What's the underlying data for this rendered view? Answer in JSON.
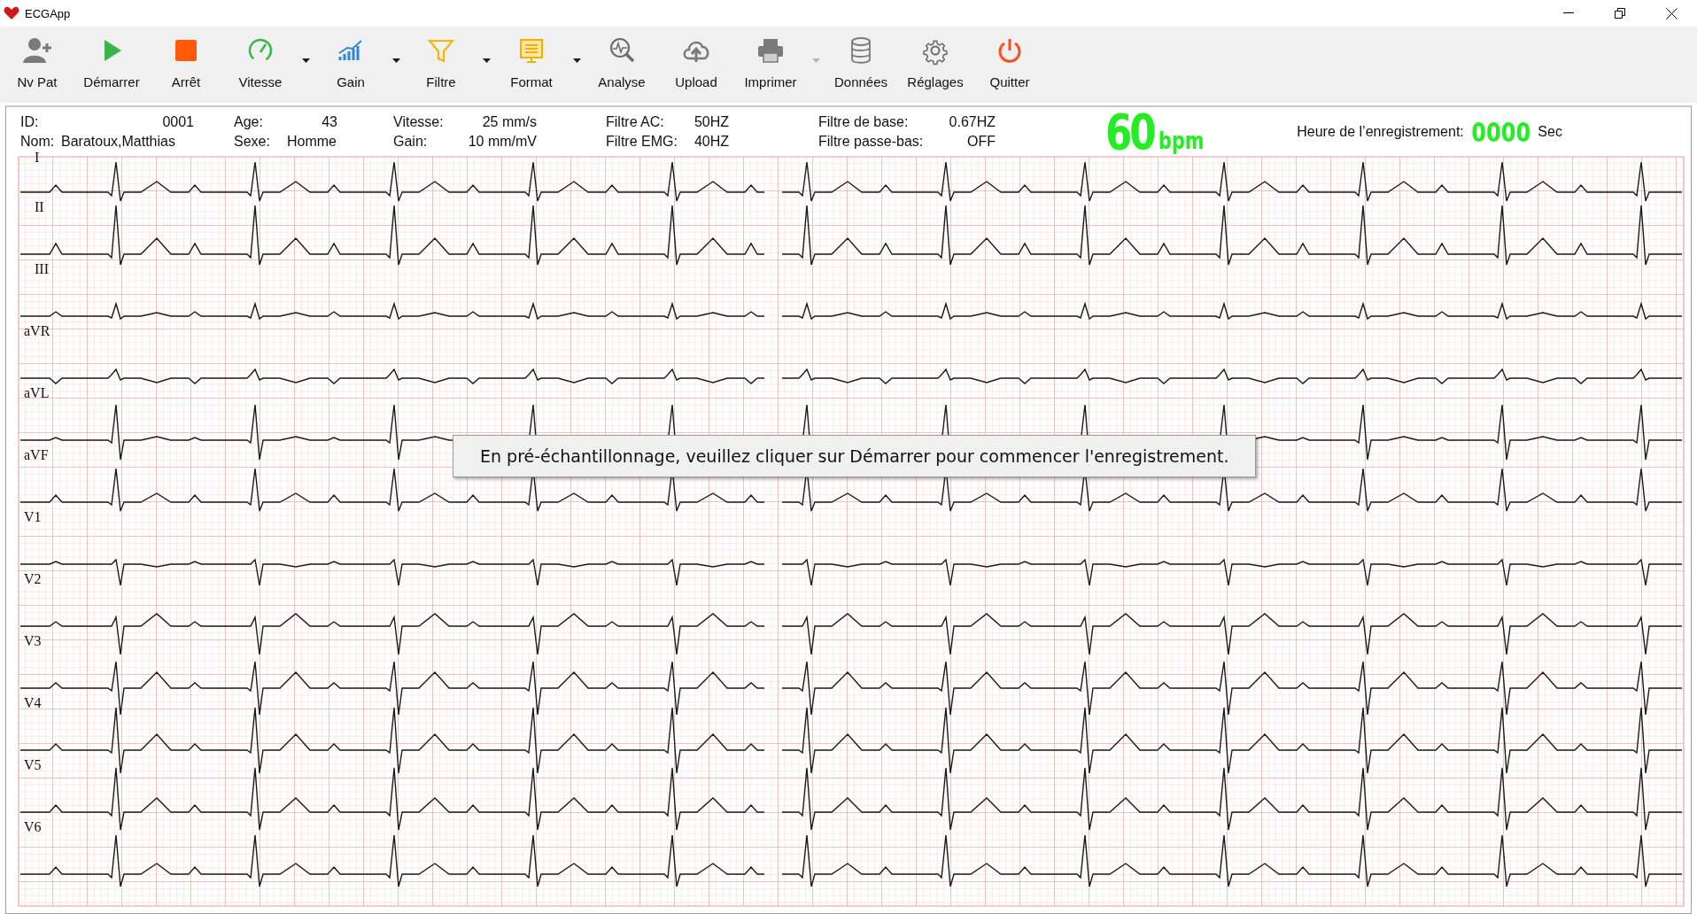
{
  "window": {
    "title": "ECGApp"
  },
  "toolbar": [
    {
      "label": "Nv Pat"
    },
    {
      "label": "Démarrer"
    },
    {
      "label": "Arrêt"
    },
    {
      "label": "Vitesse",
      "dropdown": true,
      "dropdown_disabled": false
    },
    {
      "label": "Gain",
      "dropdown": true,
      "dropdown_disabled": false
    },
    {
      "label": "Filtre",
      "dropdown": true,
      "dropdown_disabled": false
    },
    {
      "label": "Format",
      "dropdown": true,
      "dropdown_disabled": false
    },
    {
      "label": "Analyse"
    },
    {
      "label": "Upload"
    },
    {
      "label": "Imprimer",
      "dropdown": true,
      "dropdown_disabled": true
    },
    {
      "label": "Données"
    },
    {
      "label": "Réglages"
    },
    {
      "label": "Quitter"
    }
  ],
  "patient_info": [
    {
      "label": "ID:",
      "value": "0001",
      "label2": "Nom:",
      "value2": "Baratoux,Matthias"
    },
    {
      "label": "Age:",
      "value": "43",
      "label2": "Sexe:",
      "value2": "Homme"
    },
    {
      "label": "Vitesse:",
      "value": "25 mm/s",
      "label2": "Gain:",
      "value2": "10 mm/mV"
    },
    {
      "label": "Filtre AC:",
      "value": "50HZ",
      "label2": "Filtre EMG:",
      "value2": "40HZ"
    },
    {
      "label": "Filtre de base:",
      "value": "0.67HZ",
      "label2": "Filtre passe-bas:",
      "value2": "OFF"
    }
  ],
  "heart_rate": {
    "value": "60",
    "unit": "bpm"
  },
  "recording_time": {
    "label": "Heure de l’enregistrement:",
    "value": "0000",
    "unit": "Sec"
  },
  "leads": [
    {
      "label": "I"
    },
    {
      "label": "II"
    },
    {
      "label": "III"
    },
    {
      "label": "aVR"
    },
    {
      "label": "aVL"
    },
    {
      "label": "aVF"
    },
    {
      "label": "V1"
    },
    {
      "label": "V2"
    },
    {
      "label": "V3"
    },
    {
      "label": "V4"
    },
    {
      "label": "V5"
    },
    {
      "label": "V6"
    }
  ],
  "message": "En pré-échantillonnage, veuillez cliquer sur Démarrer pour commencer l'enregistrement."
}
